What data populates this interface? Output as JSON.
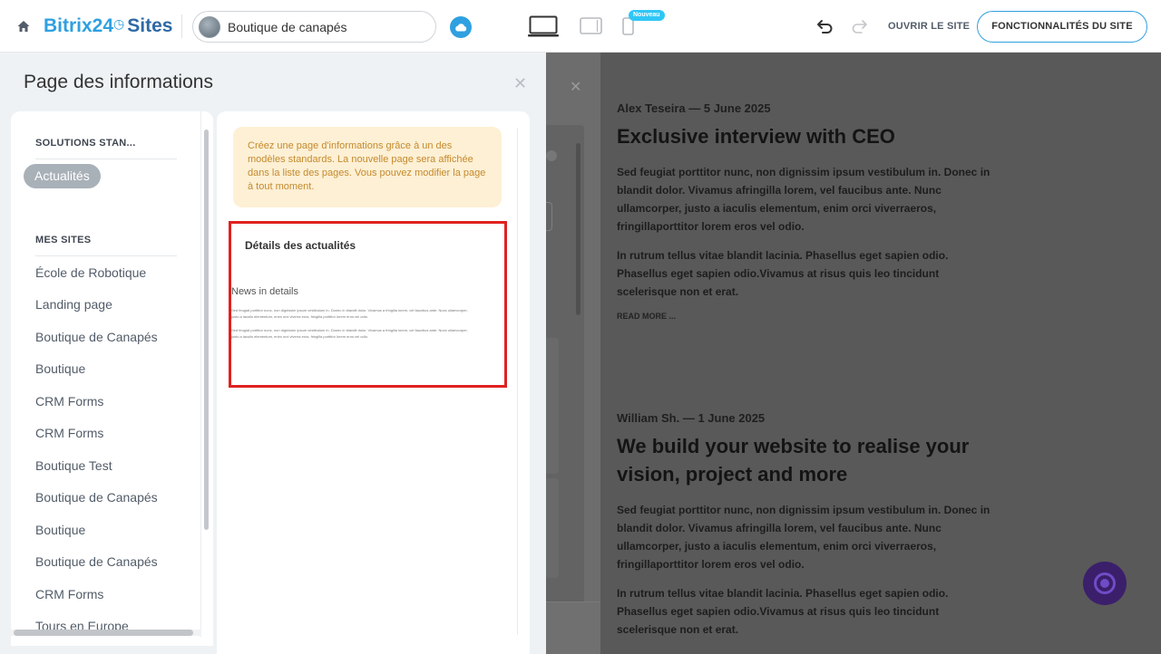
{
  "header": {
    "logo_b24": "Bitrix24",
    "logo_sites": "Sites",
    "site_name": "Boutique de canapés",
    "new_badge": "Nouveau",
    "open_site": "OUVRIR LE SITE",
    "features": "FONCTIONNALITÉS DU SITE"
  },
  "panel": {
    "title": "Page des informations",
    "sections": [
      {
        "label": "SOLUTIONS STAN..."
      },
      {
        "label": "MES SITES"
      }
    ],
    "active_item": "Actualités",
    "sites": [
      "École de Robotique",
      "Landing page",
      "Boutique de Canapés",
      "Boutique",
      "CRM Forms",
      "CRM Forms",
      "Boutique Test",
      "Boutique de Canapés",
      "Boutique",
      "Boutique de Canapés",
      "CRM Forms",
      "Tours en Europe"
    ],
    "notice": "Créez une page d'informations grâce à un des modèles standards. La nouvelle page sera affichée dans la liste des pages. Vous pouvez modifier la page à tout moment.",
    "template": {
      "title": "Détails des actualités",
      "subtitle": "News in details",
      "line1": "Sed feugiat porttitor nunc, non dignissim ipsum vestibulum in. Donec in blandit dolor. Vivamus a fringilla lorem, vel faucibus ante. Nunc ullamcorper,",
      "line2": "justo a iaculis elementum, enim orci viverra eros, fringilla porttitor lorem eros vel odio.",
      "line3": "Sed feugiat porttitor nunc, non dignissim ipsum vestibulum in. Donec in blandit dolor. Vivamus a fringilla lorem, vel faucibus ante. Nunc ullamcorper,",
      "line4": "justo a iaculis elementum, enim orci viverra eros, fringilla porttitor lorem eros vel odio."
    }
  },
  "preview": {
    "article1": {
      "meta": "Alex Teseira — 5 June 2025",
      "title": "Exclusive interview with CEO",
      "p1": "Sed feugiat porttitor nunc, non dignissim ipsum vestibulum in. Donec in blandit dolor. Vivamus afringilla lorem, vel faucibus ante. Nunc ullamcorper, justo a iaculis elementum, enim orci viverraeros, fringillaporttitor lorem eros vel odio.",
      "p2": "In rutrum tellus vitae blandit lacinia. Phasellus eget sapien odio. Phasellus eget sapien odio.Vivamus at risus quis leo tincidunt scelerisque non et erat.",
      "readmore": "READ MORE ..."
    },
    "article2": {
      "meta": "William Sh. — 1 June 2025",
      "title": "We build your website to realise your vision, project and more",
      "p1": "Sed feugiat porttitor nunc, non dignissim ipsum vestibulum in. Donec in blandit dolor. Vivamus afringilla lorem, vel faucibus ante. Nunc ullamcorper, justo a iaculis elementum, enim orci viverraeros, fringillaporttitor lorem eros vel odio.",
      "p2": "In rutrum tellus vitae blandit lacinia. Phasellus eget sapien odio. Phasellus eget sapien odio.Vivamus at risus quis leo tincidunt scelerisque non et erat."
    }
  },
  "colors": {
    "accent": "#2fa0e0",
    "highlight_border": "#e02020",
    "notice_bg": "#fdf0d5",
    "notice_text": "#c58a2d"
  },
  "icons": {
    "home": "home-icon",
    "cloud": "cloud-icon",
    "desktop": "desktop-device-icon",
    "tablet": "tablet-device-icon",
    "mobile": "mobile-device-icon",
    "undo": "undo-icon",
    "redo": "redo-icon",
    "close": "close-icon",
    "assistant": "assistant-icon"
  }
}
